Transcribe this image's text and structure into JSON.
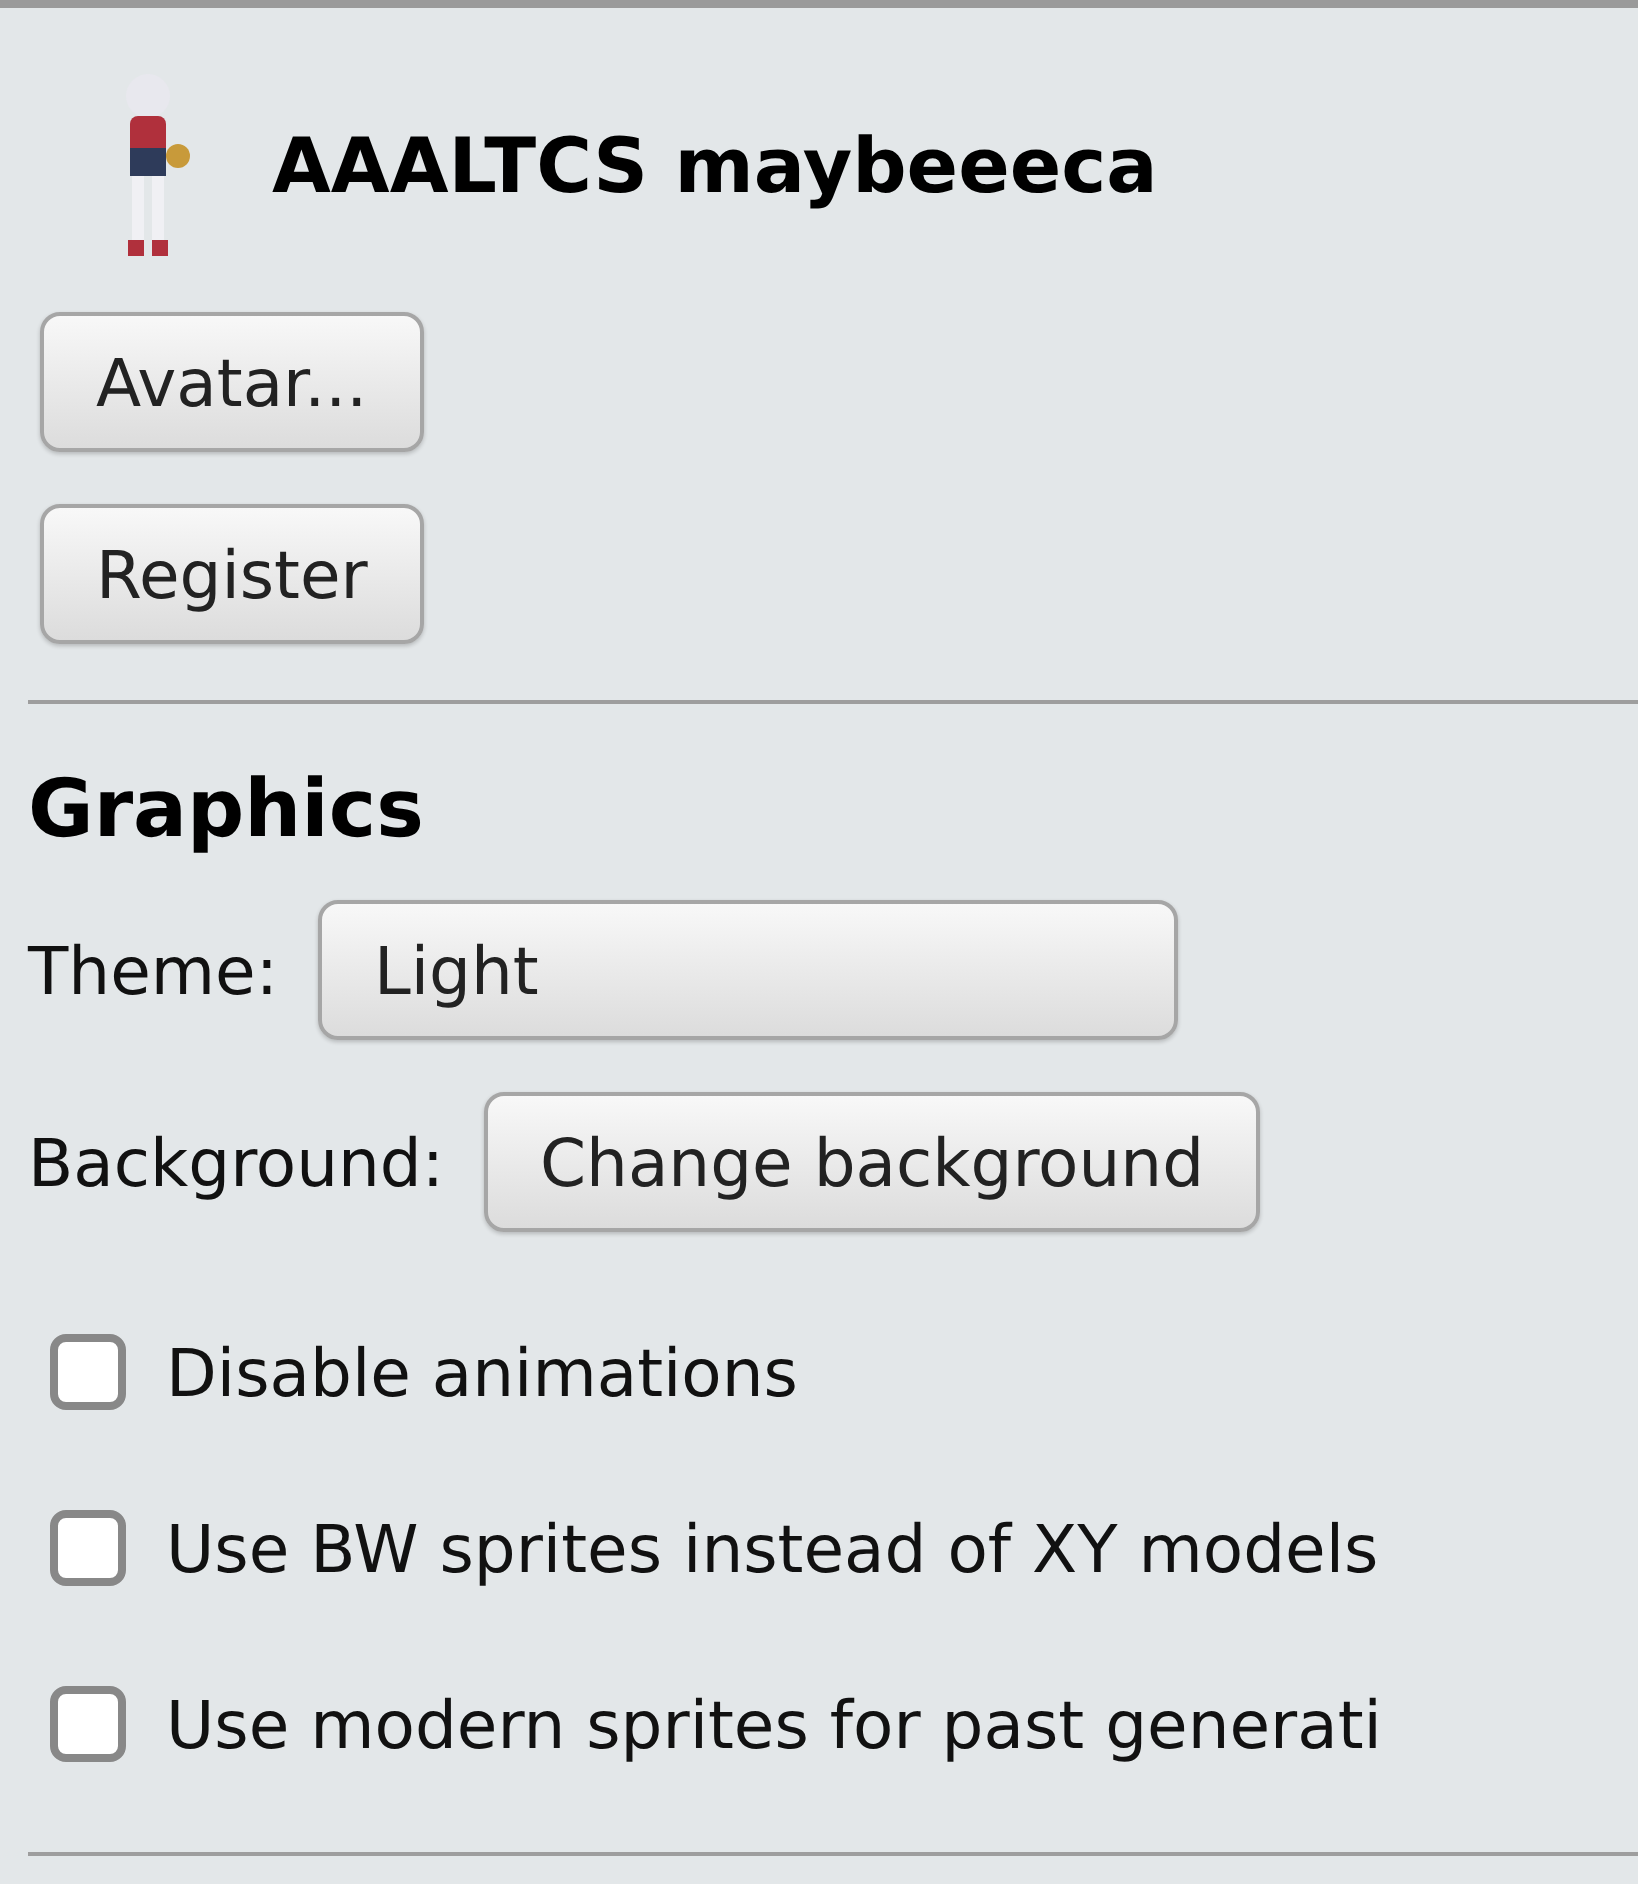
{
  "user": {
    "name": "AAALTCS maybeeeca"
  },
  "account_buttons": [
    "Avatar...",
    "Register"
  ],
  "graphics": {
    "heading": "Graphics",
    "theme": {
      "label": "Theme:",
      "value": "Light"
    },
    "background": {
      "label": "Background:",
      "button": "Change background"
    },
    "options": [
      {
        "label": "Disable animations",
        "checked": false
      },
      {
        "label": "Use BW sprites instead of XY models",
        "checked": false
      },
      {
        "label": "Use modern sprites for past generati",
        "checked": false
      }
    ]
  }
}
